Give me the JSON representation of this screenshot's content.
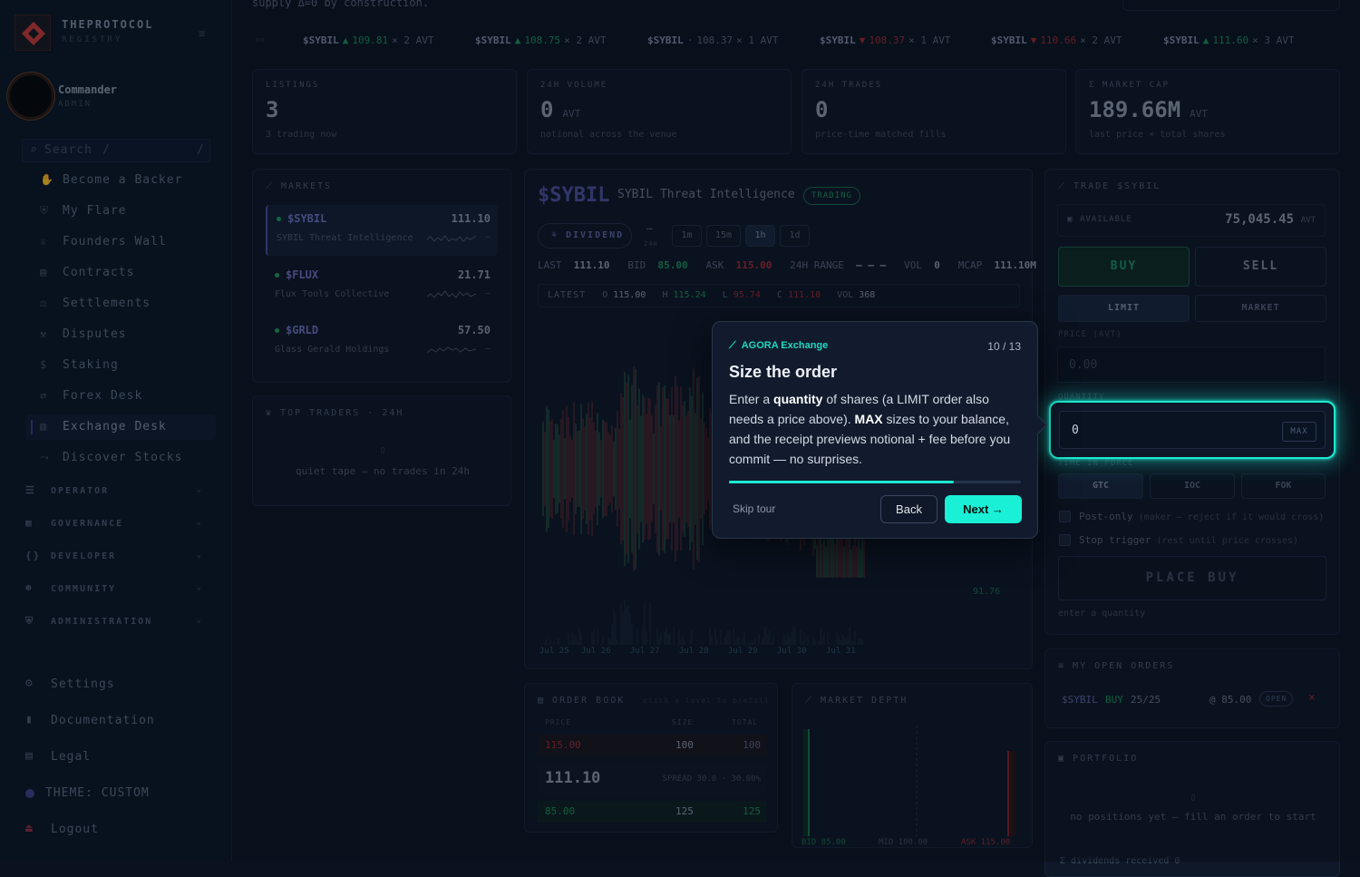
{
  "sidebar": {
    "brand_title": "THEPROTOCOL",
    "brand_sub": "REGISTRY",
    "user_name": "Commander",
    "user_role": "ADMIN",
    "search_placeholder": "Search",
    "search_shortcut": "/",
    "items": [
      {
        "label": "Become a Backer",
        "icon": "hand-icon"
      },
      {
        "label": "My Flare",
        "icon": "shield-icon"
      },
      {
        "label": "Founders Wall",
        "icon": "trophy-icon"
      },
      {
        "label": "Contracts",
        "icon": "document-icon"
      },
      {
        "label": "Settlements",
        "icon": "scale-icon"
      },
      {
        "label": "Disputes",
        "icon": "gavel-icon"
      },
      {
        "label": "Staking",
        "icon": "dollar-icon"
      },
      {
        "label": "Forex Desk",
        "icon": "exchange-icon"
      },
      {
        "label": "Exchange Desk",
        "icon": "chart-icon",
        "active": true
      },
      {
        "label": "Discover Stocks",
        "icon": "trend-icon"
      }
    ],
    "groups": [
      "OPERATOR",
      "GOVERNANCE",
      "DEVELOPER",
      "COMMUNITY",
      "ADMINISTRATION"
    ],
    "footer": {
      "settings": "Settings",
      "docs": "Documentation",
      "legal": "Legal",
      "theme": "THEME: CUSTOM",
      "logout": "Logout"
    }
  },
  "top_note": "supply Δ=0 by construction.",
  "ticker": [
    {
      "sym": "$SYBIL",
      "dir": "▲",
      "price": "109.81",
      "qty": "× 2 AVT",
      "trend": "up"
    },
    {
      "sym": "$SYBIL",
      "dir": "▲",
      "price": "108.75",
      "qty": "× 2 AVT",
      "trend": "up"
    },
    {
      "sym": "$SYBIL",
      "dir": "·",
      "price": "108.37",
      "qty": "× 1 AVT",
      "trend": "flat"
    },
    {
      "sym": "$SYBIL",
      "dir": "▼",
      "price": "108.37",
      "qty": "× 1 AVT",
      "trend": "down"
    },
    {
      "sym": "$SYBIL",
      "dir": "▼",
      "price": "110.66",
      "qty": "× 2 AVT",
      "trend": "down"
    },
    {
      "sym": "$SYBIL",
      "dir": "▲",
      "price": "111.60",
      "qty": "× 3 AVT",
      "trend": "up"
    }
  ],
  "kpis": [
    {
      "label": "LISTINGS",
      "value": "3",
      "unit": "",
      "note": "3 trading now"
    },
    {
      "label": "24H VOLUME",
      "value": "0",
      "unit": "AVT",
      "note": "notional across the venue"
    },
    {
      "label": "24H TRADES",
      "value": "0",
      "unit": "",
      "note": "price-time matched fills"
    },
    {
      "label": "Σ MARKET CAP",
      "value": "189.66M",
      "unit": "AVT",
      "note": "last price × total shares"
    }
  ],
  "markets": {
    "title": "MARKETS",
    "rows": [
      {
        "sym": "$SYBIL",
        "price": "111.10",
        "name": "SYBIL Threat Intelligence",
        "dash": "–"
      },
      {
        "sym": "$FLUX",
        "price": "21.71",
        "name": "Flux Tools Collective",
        "dash": "–"
      },
      {
        "sym": "$GRLD",
        "price": "57.50",
        "name": "Glass Gerald Holdings",
        "dash": "–"
      }
    ]
  },
  "top_traders": {
    "title": "TOP TRADERS · 24H",
    "empty": "quiet tape — no trades in 24h"
  },
  "instrument": {
    "sym": "$SYBIL",
    "name": "SYBIL Threat Intelligence",
    "status": "TRADING",
    "dividend": "DIVIDEND",
    "h24_label": "24H",
    "h24_value": "—",
    "intervals": [
      "1m",
      "15m",
      "1h",
      "1d"
    ],
    "active_interval": "1h",
    "stats": {
      "last_l": "LAST",
      "last": "111.10",
      "bid_l": "BID",
      "bid": "85.00",
      "ask_l": "ASK",
      "ask": "115.00",
      "range_l": "24H RANGE",
      "range": "— — —",
      "vol_l": "VOL",
      "vol": "0",
      "mcap_l": "MCAP",
      "mcap": "111.10M"
    },
    "ohlc": {
      "latest": "LATEST",
      "o_l": "O",
      "o": "115.00",
      "h_l": "H",
      "h": "115.24",
      "l_l": "L",
      "l": "95.74",
      "c_l": "C",
      "c": "111.10",
      "v_l": "VOL",
      "v": "368"
    },
    "price_axis": "91.76",
    "dates": [
      "Jul 25",
      "Jul 26",
      "Jul 27",
      "Jul 28",
      "Jul 29",
      "Jul 30",
      "Jul 31"
    ]
  },
  "order_book": {
    "title": "ORDER BOOK",
    "hint": "click a level to prefill",
    "cols": [
      "PRICE",
      "SIZE",
      "TOTAL"
    ],
    "ask": {
      "price": "115.00",
      "size": "100",
      "total": "100"
    },
    "mid": "111.10",
    "spread": "SPREAD 30.0 · 30.00%",
    "bid": {
      "price": "85.00",
      "size": "125",
      "total": "125"
    }
  },
  "depth": {
    "title": "MARKET DEPTH",
    "bid": "BID 85.00",
    "mid": "MID 100.00",
    "ask": "ASK 115.00"
  },
  "trade": {
    "title": "TRADE $SYBIL",
    "available_l": "AVAILABLE",
    "available": "75,045.45",
    "available_u": "AVT",
    "buy": "BUY",
    "sell": "SELL",
    "limit": "LIMIT",
    "market": "MARKET",
    "price_l": "PRICE (AVT)",
    "price_ph": "0.00",
    "qty_l": "QUANTITY",
    "qty": "0",
    "max": "MAX",
    "tif_l": "TIME IN FORCE",
    "tif": [
      "GTC",
      "IOC",
      "FOK"
    ],
    "post_only": "Post-only",
    "post_only_hint": "(maker — reject if it would cross)",
    "stop": "Stop trigger",
    "stop_hint": "(rest until price crosses)",
    "place": "PLACE BUY",
    "footer": "enter a quantity"
  },
  "open_orders": {
    "title": "MY OPEN ORDERS",
    "sym": "$SYBIL",
    "side": "BUY",
    "qty": "25/25",
    "price": "@ 85.00",
    "status": "OPEN",
    "cancel": "×"
  },
  "portfolio": {
    "title": "PORTFOLIO",
    "empty": "no positions yet — fill an order to start",
    "div": "Σ dividends received 0"
  },
  "tour": {
    "badge": "AGORA Exchange",
    "counter": "10 / 13",
    "title": "Size the order",
    "body_1": "Enter a ",
    "body_b1": "quantity",
    "body_2": " of shares (a LIMIT order also needs a price above). ",
    "body_b2": "MAX",
    "body_3": " sizes to your balance, and the receipt previews notional + fee before you commit — no surprises.",
    "progress": 0.77,
    "skip": "Skip tour",
    "back": "Back",
    "next": "Next →"
  },
  "colors": {
    "accent": "#1ee8d0",
    "up": "#1d9a5e",
    "down": "#b0303a",
    "brand": "#c43a3a"
  }
}
